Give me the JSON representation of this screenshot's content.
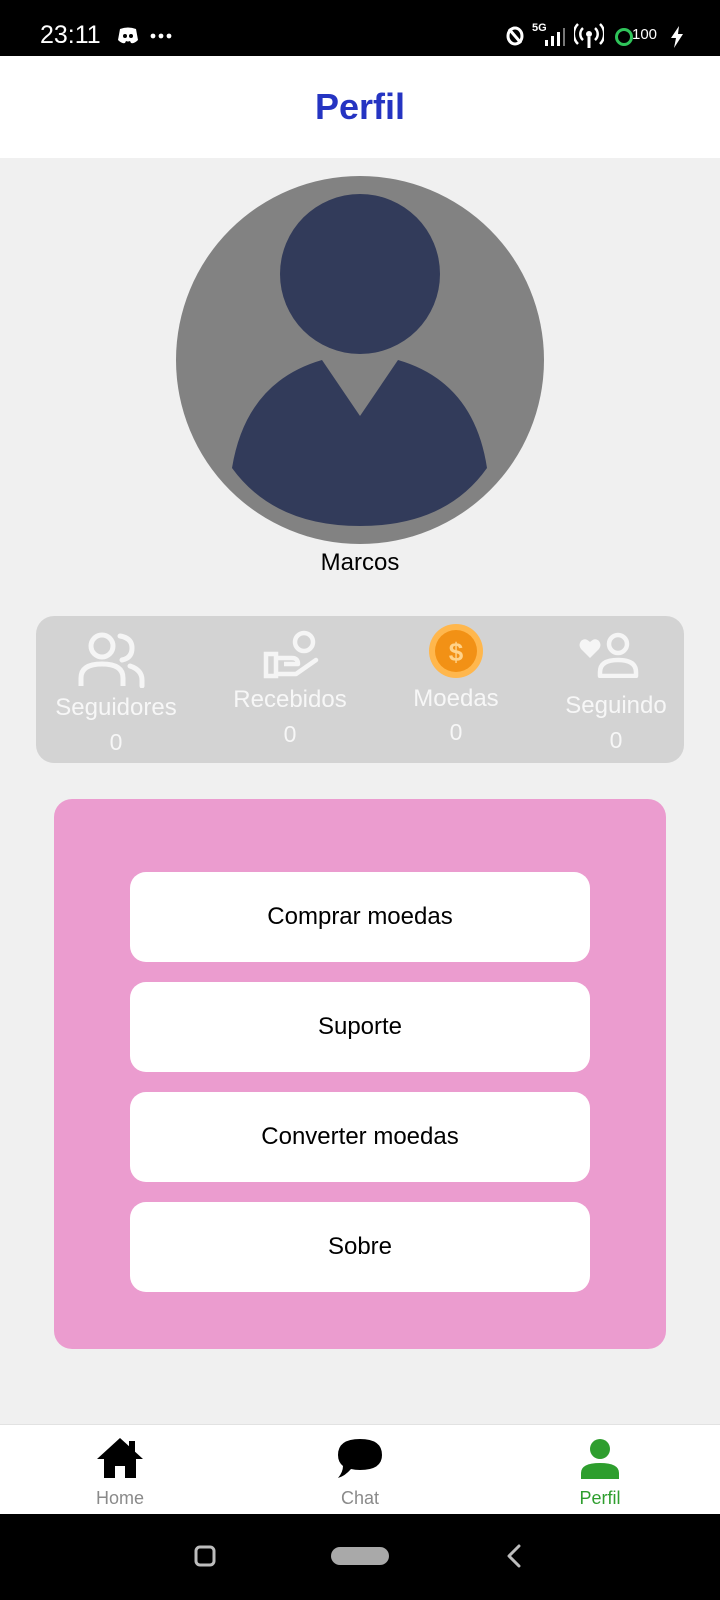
{
  "status_bar": {
    "time": "23:11",
    "battery": "100",
    "network": "5G",
    "icons": [
      "discord-icon",
      "more-dots-icon",
      "blocked-icon",
      "signal-5g-icon",
      "hotspot-icon",
      "battery-icon",
      "charging-icon"
    ]
  },
  "header": {
    "title": "Perfil",
    "title_color": "#2534c2"
  },
  "profile": {
    "name": "Marcos",
    "avatar_icon": "default-user-avatar-icon"
  },
  "stats": [
    {
      "label": "Seguidores",
      "value": "0",
      "icon": "followers-icon"
    },
    {
      "label": "Recebidos",
      "value": "0",
      "icon": "received-gift-icon"
    },
    {
      "label": "Moedas",
      "value": "0",
      "icon": "coin-icon"
    },
    {
      "label": "Seguindo",
      "value": "0",
      "icon": "following-heart-user-icon"
    }
  ],
  "menu": {
    "background": "#eb9ccf",
    "buttons": [
      {
        "label": "Comprar moedas"
      },
      {
        "label": "Suporte"
      },
      {
        "label": "Converter moedas"
      },
      {
        "label": "Sobre"
      }
    ]
  },
  "bottom_nav": {
    "items": [
      {
        "label": "Home",
        "icon": "home-icon",
        "active": false
      },
      {
        "label": "Chat",
        "icon": "chat-bubble-icon",
        "active": false
      },
      {
        "label": "Perfil",
        "icon": "person-icon",
        "active": true
      }
    ],
    "active_color": "#2e9e2e",
    "inactive_color": "#8a8a8a"
  },
  "system_nav": {
    "icons": [
      "recents-icon",
      "home-pill-icon",
      "back-icon"
    ]
  }
}
